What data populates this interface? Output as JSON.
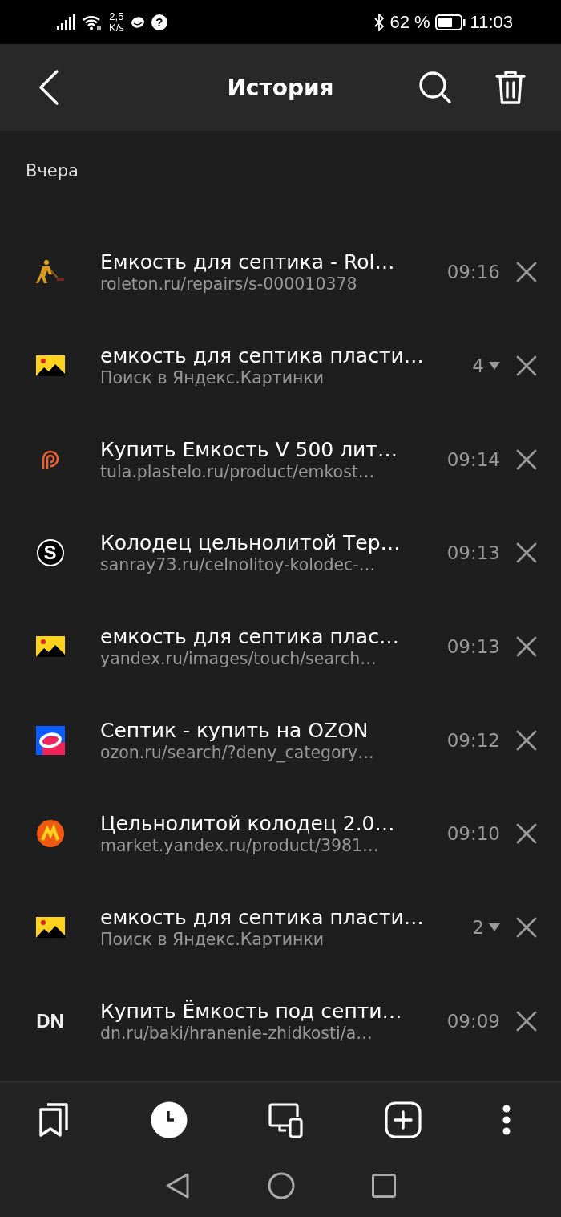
{
  "status_bar": {
    "speed_value": "2,5",
    "speed_unit": "K/s",
    "help_glyph": "?",
    "battery": "62 %",
    "time": "11:03"
  },
  "header": {
    "title": "История"
  },
  "section": "Вчера",
  "items": [
    {
      "kind": "worker",
      "title": "Емкость для септика - Rol…",
      "subtitle": "roleton.ru/repairs/s-000010378",
      "time": "09:16"
    },
    {
      "kind": "images",
      "title": "емкость для септика пласти…",
      "subtitle": "Поиск в Яндекс.Картинки",
      "count": "4"
    },
    {
      "kind": "plastelo",
      "title": "Купить Емкость V 500 лит…",
      "subtitle": "tula.plastelo.ru/product/emkost…",
      "time": "09:14"
    },
    {
      "kind": "letter",
      "favicon_text": "S",
      "title": "Колодец цельнолитой Тер…",
      "subtitle": "sanray73.ru/celnolitoy-kolodec-…",
      "time": "09:13"
    },
    {
      "kind": "images",
      "title": "емкость для септика плас…",
      "subtitle": "yandex.ru/images/touch/search…",
      "time": "09:13"
    },
    {
      "kind": "ozon",
      "title": "Септик - купить на OZON",
      "subtitle": "ozon.ru/search/?deny_category…",
      "time": "09:12"
    },
    {
      "kind": "market",
      "title": "Цельнолитой колодец 2.0…",
      "subtitle": "market.yandex.ru/product/3981…",
      "time": "09:10"
    },
    {
      "kind": "images",
      "title": "емкость для септика пласти…",
      "subtitle": "Поиск в Яндекс.Картинки",
      "count": "2"
    },
    {
      "kind": "text",
      "favicon_text": "DN",
      "title": "Купить Ёмкость под септи…",
      "subtitle": "dn.ru/baki/hranenie-zhidkosti/a…",
      "time": "09:09"
    }
  ],
  "toolbar": [
    {
      "kind": "bookmarks",
      "selected": false
    },
    {
      "kind": "history",
      "selected": true
    },
    {
      "kind": "devices",
      "selected": false
    },
    {
      "kind": "new-tab",
      "selected": false
    },
    {
      "kind": "more",
      "selected": false
    }
  ]
}
